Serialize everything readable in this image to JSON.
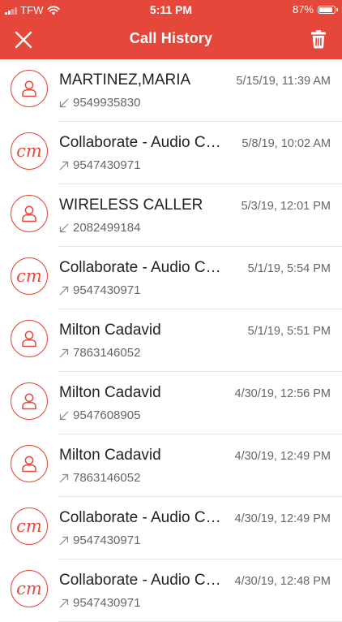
{
  "status_bar": {
    "carrier": "TFW",
    "time": "5:11 PM",
    "battery_text": "87%",
    "battery_level": 0.87
  },
  "nav": {
    "title": "Call History",
    "close_icon": "close-icon",
    "delete_icon": "trash-icon"
  },
  "colors": {
    "accent": "#e5483b"
  },
  "calls": [
    {
      "name": "MARTINEZ,MARIA",
      "number": "9549935830",
      "datetime": "5/15/19, 11:39 AM",
      "direction": "incoming",
      "avatar": "person"
    },
    {
      "name": "Collaborate - Audio Conference",
      "number": "9547430971",
      "datetime": "5/8/19, 10:02 AM",
      "direction": "outgoing",
      "avatar": "cm"
    },
    {
      "name": "WIRELESS CALLER",
      "number": "2082499184",
      "datetime": "5/3/19, 12:01 PM",
      "direction": "incoming",
      "avatar": "person"
    },
    {
      "name": "Collaborate - Audio Conference",
      "number": "9547430971",
      "datetime": "5/1/19, 5:54 PM",
      "direction": "outgoing",
      "avatar": "cm"
    },
    {
      "name": "Milton Cadavid",
      "number": "7863146052",
      "datetime": "5/1/19, 5:51 PM",
      "direction": "outgoing",
      "avatar": "person"
    },
    {
      "name": "Milton Cadavid",
      "number": "9547608905",
      "datetime": "4/30/19, 12:56 PM",
      "direction": "incoming",
      "avatar": "person"
    },
    {
      "name": "Milton Cadavid",
      "number": "7863146052",
      "datetime": "4/30/19, 12:49 PM",
      "direction": "outgoing",
      "avatar": "person"
    },
    {
      "name": "Collaborate - Audio Conference",
      "number": "9547430971",
      "datetime": "4/30/19, 12:49 PM",
      "direction": "outgoing",
      "avatar": "cm"
    },
    {
      "name": "Collaborate - Audio Conference",
      "number": "9547430971",
      "datetime": "4/30/19, 12:48 PM",
      "direction": "outgoing",
      "avatar": "cm"
    }
  ],
  "cm_text": "cm"
}
